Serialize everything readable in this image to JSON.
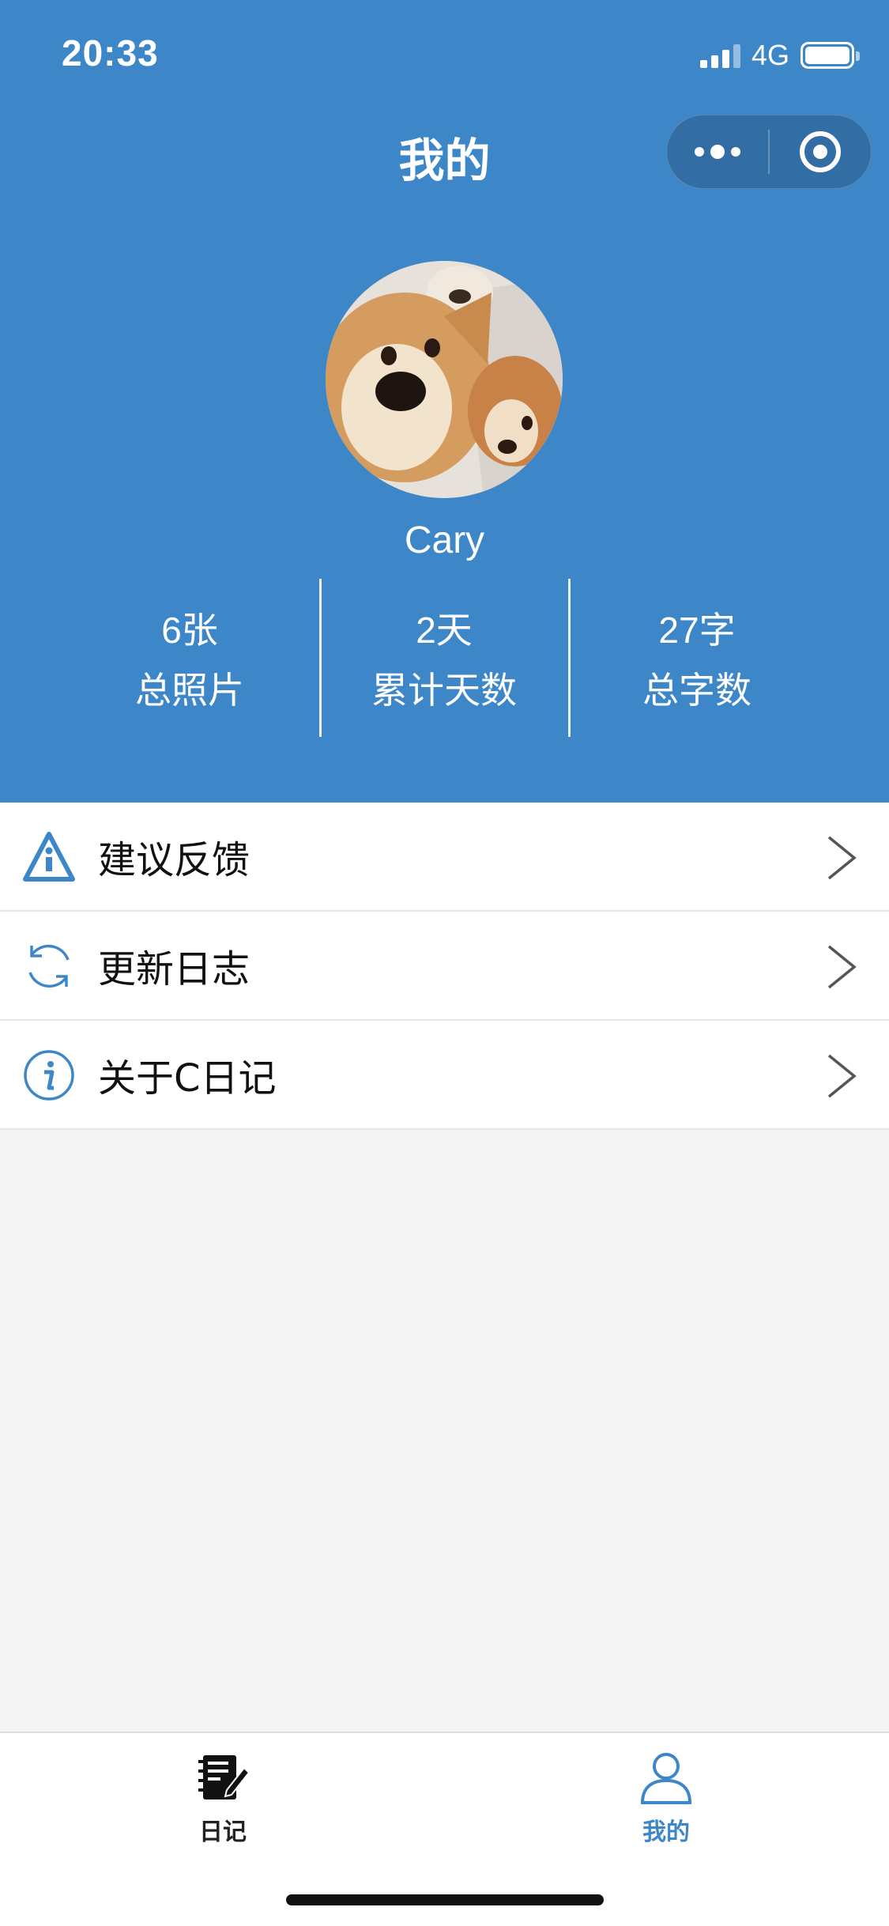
{
  "status_bar": {
    "time": "20:33",
    "network": "4G"
  },
  "nav": {
    "title": "我的"
  },
  "profile": {
    "username": "Cary",
    "stats": [
      {
        "value": "6张",
        "label": "总照片"
      },
      {
        "value": "2天",
        "label": "累计天数"
      },
      {
        "value": "27字",
        "label": "总字数"
      }
    ]
  },
  "menu": {
    "items": [
      {
        "label": "建议反馈",
        "icon": "warning-triangle-icon"
      },
      {
        "label": "更新日志",
        "icon": "refresh-icon"
      },
      {
        "label": "关于C日记",
        "icon": "info-icon"
      }
    ]
  },
  "tabbar": {
    "tabs": [
      {
        "label": "日记",
        "icon": "diary-edit-icon",
        "active": false
      },
      {
        "label": "我的",
        "icon": "user-icon",
        "active": true
      }
    ]
  },
  "colors": {
    "primary": "#3d87c9",
    "background": "#f4f4f4",
    "tab_active": "#3d87c9",
    "tab_inactive": "#222222"
  }
}
